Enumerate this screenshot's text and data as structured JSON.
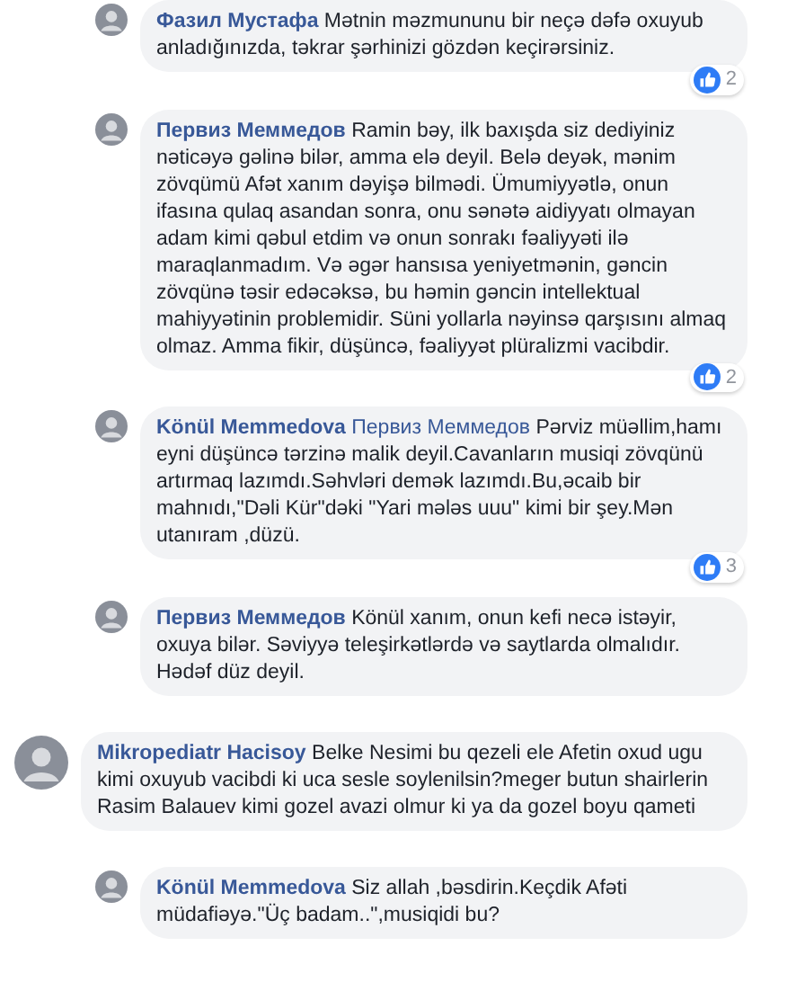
{
  "comments": [
    {
      "author": "Фазил Мустафа",
      "reply": true,
      "text": "Mətnin məzmununu bir neçə dəfə oxuyub anladığınızda, təkrar şərhinizi gözdən keçirərsiniz.",
      "likes": "2"
    },
    {
      "author": "Первиз Меммедов",
      "reply": true,
      "text": "Ramin bəy, ilk baxışda siz dediyiniz nəticəyə gəlinə bilər, amma elə deyil. Belə deyək, mənim zövqümü Afət xanım dəyişə bilmədi. Ümumiyyətlə, onun ifasına qulaq asandan sonra, onu sənətə aidiyyatı olmayan adam kimi qəbul etdim və onun sonrakı fəaliyyəti ilə maraqlanmadım. Və əgər hansısa yeniyetmənin, gəncin zövqünə təsir edəcəksə, bu həmin gəncin intellektual mahiyyətinin problemidir. Süni yollarla nəyinsə qarşısını almaq olmaz. Amma fikir, düşüncə, fəaliyyət plüralizmi vacibdir.",
      "likes": "2"
    },
    {
      "author": "Könül Memmedova",
      "mention": "Первиз Меммедов",
      "reply": true,
      "text": "Pərviz müəllim,hamı eyni düşüncə tərzinə malik deyil.Cavanların musiqi zövqünü artırmaq lazımdı.Səhvləri demək lazımdı.Bu,əcaib bir mahnıdı,\"Dəli Kür\"dəki \"Yari mələs uuu\" kimi bir şey.Mən utanıram ,düzü.",
      "likes": "3"
    },
    {
      "author": "Первиз Меммедов",
      "reply": true,
      "text": "Könül xanım, onun kefi necə istəyir, oxuya bilər. Səviyyə teleşirkətlərdə və saytlarda olmalıdır. Hədəf düz deyil."
    },
    {
      "author": "Mikropediatr Hacisoy",
      "reply": false,
      "text": "Belke Nesimi bu qezeli ele Afetin oxud ugu kimi oxuyub vacibdi ki uca sesle soylenilsin?meger butun shairlerin Rasim Balauev kimi gozel avazi olmur ki ya da gozel boyu qameti"
    },
    {
      "author": "Könül Memmedova",
      "reply": true,
      "text": "Siz allah ,bəsdirin.Keçdik Afəti müdafiəyə.\"Üç badam..\",musiqidi bu?"
    }
  ]
}
